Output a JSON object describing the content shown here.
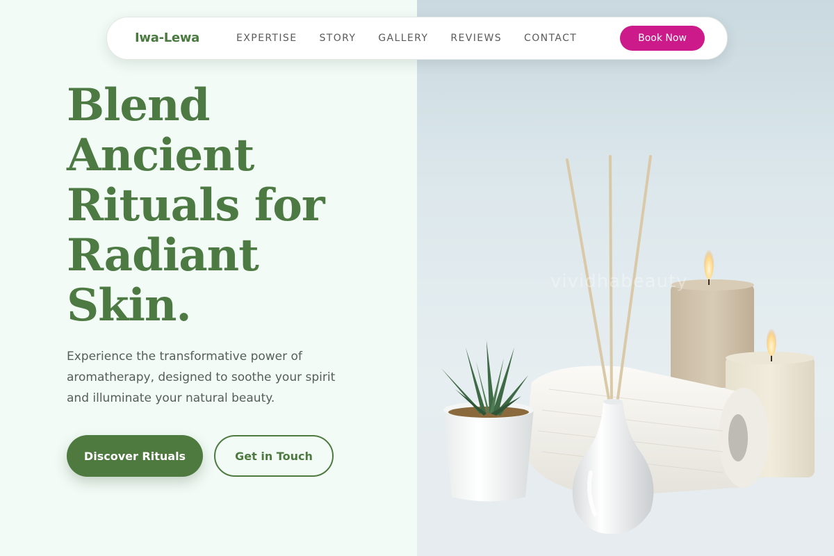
{
  "nav": {
    "logo": "Iwa-Lewa",
    "links": [
      "EXPERTISE",
      "STORY",
      "GALLERY",
      "REVIEWS",
      "CONTACT"
    ],
    "cta": "Book Now"
  },
  "hero": {
    "title_lines": [
      "Blend",
      "Ancient",
      "Rituals for",
      "Radiant",
      "Skin."
    ],
    "subtitle": "Experience the transformative power of aromatherapy, designed to soothe your spirit and illuminate your natural beauty.",
    "primary_button": "Discover Rituals",
    "secondary_button": "Get in Touch"
  },
  "photo": {
    "watermark": "vividhabeauty"
  },
  "colors": {
    "brand_green": "#4e7a40",
    "accent_pink": "#cc1a8a",
    "left_bg": "#f2fbf6"
  }
}
